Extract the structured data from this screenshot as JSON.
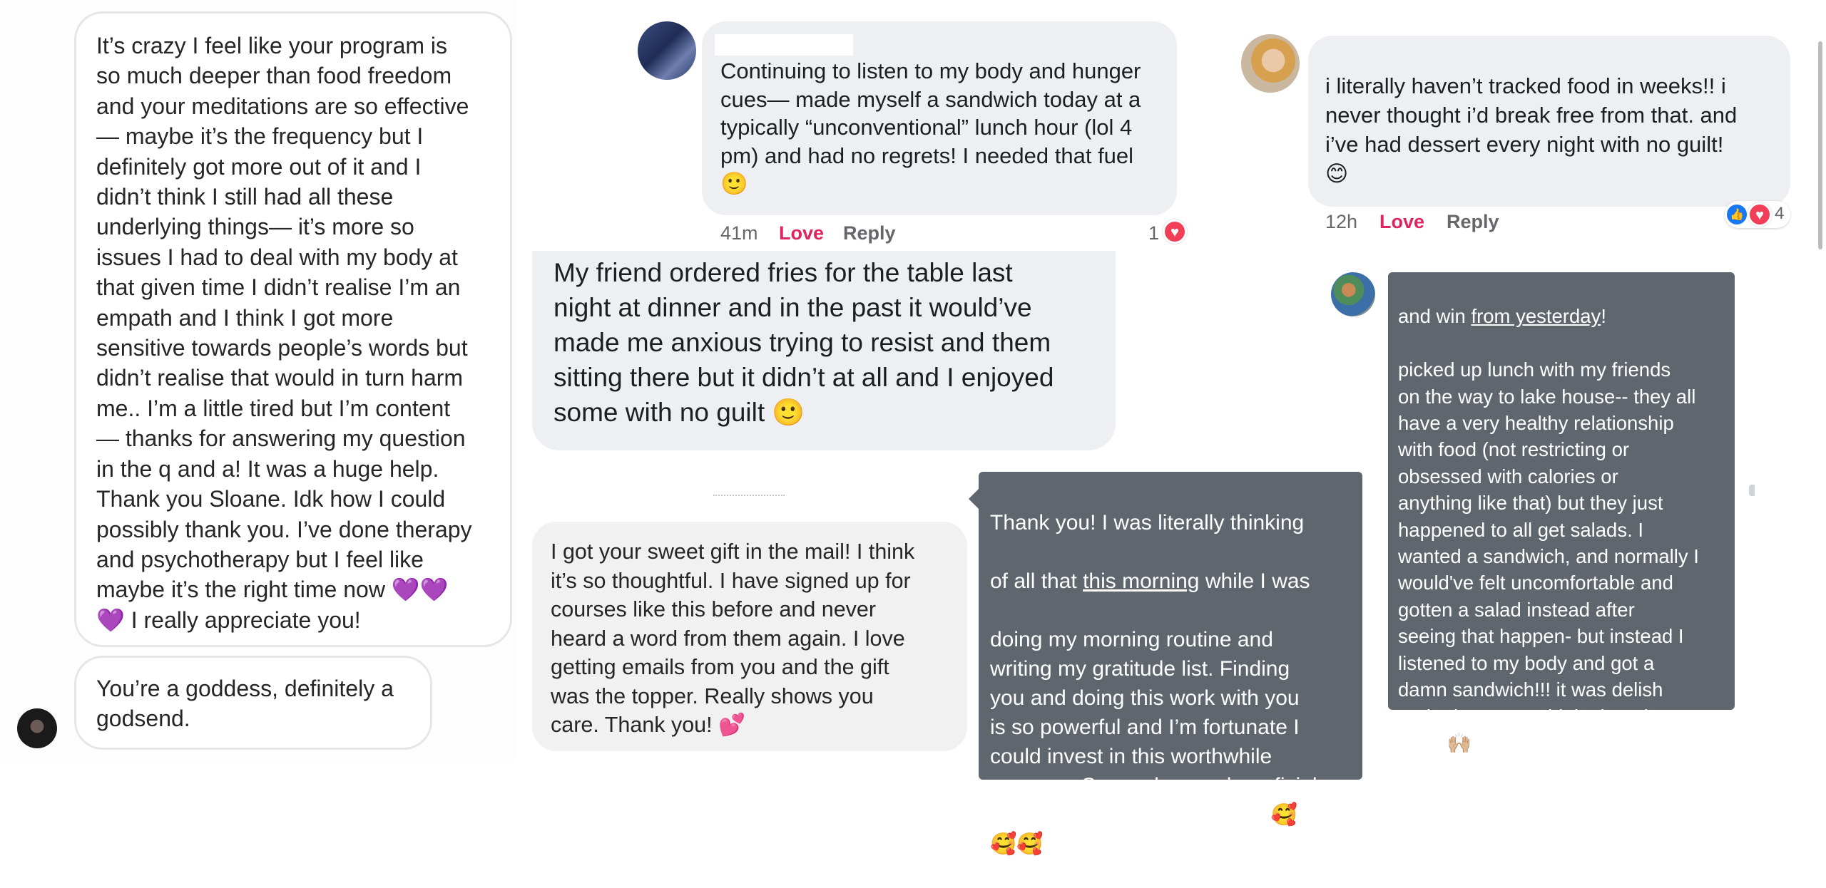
{
  "panel_left": {
    "message_1": "It’s crazy I feel like your program is\nso much deeper than food freedom\nand your meditations are so effective\n— maybe it’s the frequency but I\ndefinitely got more out of it and I\ndidn’t think I still had all these\nunderlying things— it’s more so\nissues I had to deal with my body at\nthat given time I didn’t realise I’m an\nempath and I think I got more\nsensitive towards people’s words but\ndidn’t realise that would in turn harm\nme.. I’m a little tired but I’m content\n— thanks for answering my question\nin the q and a! It was a huge help.\nThank you Sloane. Idk how I could\npossibly thank you. I’ve done therapy\nand psychotherapy but I feel like\nmaybe it’s the right time now 💜💜\n💜 I really appreciate you!",
    "message_2": "You’re a goddess, definitely a\ngodsend."
  },
  "comment_center": {
    "text": "Continuing to listen to my body and hunger\ncues— made myself a sandwich today at a\ntypically “unconventional” lunch hour (lol 4\npm) and had no regrets! I needed that fuel\n🙂",
    "time": "41m",
    "love_label": "Love",
    "reply_label": "Reply",
    "reaction_count": "1"
  },
  "fries_message": {
    "text": "My friend ordered fries for the table last\nnight at dinner and in the past it would’ve\nmade me anxious trying to resist and them\nsitting there but it didn’t at all and I enjoyed\nsome with no guilt 🙂"
  },
  "gift_message": {
    "text": "I got your sweet gift in the mail! I think\nit’s so thoughtful. I have signed up for\ncourses like this before and never\nheard a word from them again. I love\ngetting emails from you and the gift\nwas the topper. Really shows you\ncare. Thank you! 💕"
  },
  "gratitude_message": {
    "line1": "Thank you! I was literally thinking",
    "line2_pre": "of all that ",
    "line2_link": "this morning",
    "line2_post": " while I was",
    "rest": "doing my morning routine and\nwriting my gratitude list. Finding\nyou and doing this work with you\nis so powerful and I’m fortunate I\ncould invest in this worthwhile\nprogram. So much more beneficial\nthan I ever though it would be🥰\n🥰🥰"
  },
  "comment_right": {
    "text": "i literally haven’t tracked food in weeks!! i\nnever thought i’d break free from that. and\ni’ve had dessert every night with no guilt!\n😊",
    "time": "12h",
    "love_label": "Love",
    "reply_label": "Reply",
    "reaction_count": "4"
  },
  "sandwich_message": {
    "line1_pre": "and win ",
    "line1_link": "from yesterday",
    "line1_post": "!",
    "rest": "picked up lunch with my friends\non the way to lake house-- they all\nhave a very healthy relationship\nwith food (not restricting or\nobsessed with calories or\nanything like that) but they just\nhappened to all get salads. I\nwanted a sandwich, and normally I\nwould've felt uncomfortable and\ngotten a salad instead after\nseeing that happen- but instead I\nlistened to my body and got a\ndamn sandwich!!! it was delish\nand I don't even think about it\nafter. 🙌🏼"
  },
  "icons": {
    "heart": "♥",
    "like": "👍"
  },
  "colors": {
    "love_red": "#e0245e",
    "fb_bubble": "#eeeff2",
    "dark_bubble": "#5f666e"
  }
}
